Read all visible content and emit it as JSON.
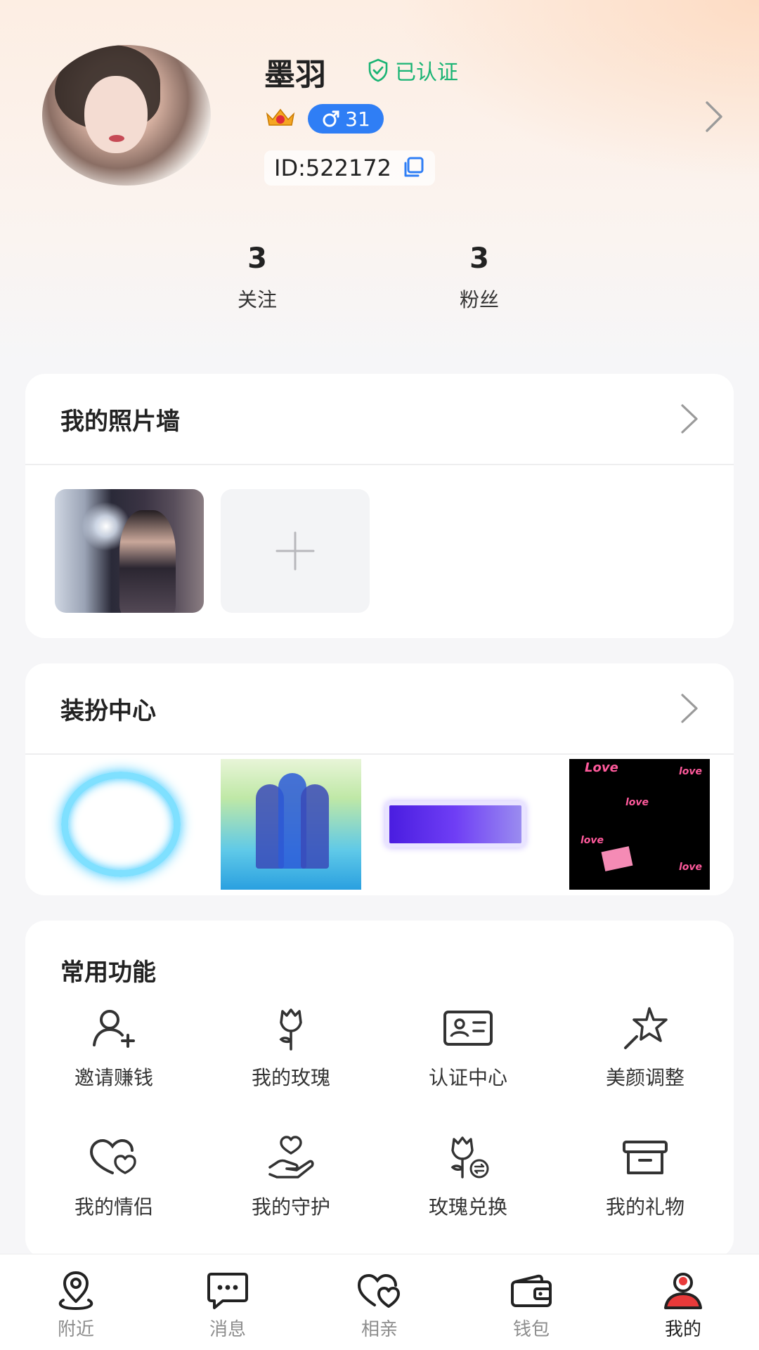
{
  "profile": {
    "name": "墨羽",
    "verified_label": "已认证",
    "gender_age": "31",
    "id_text": "ID:522172"
  },
  "stats": [
    {
      "value": "3",
      "label": "关注"
    },
    {
      "value": "3",
      "label": "粉丝"
    }
  ],
  "photo_wall": {
    "title": "我的照片墙"
  },
  "dress_center": {
    "title": "装扮中心",
    "love_texts": [
      "Love",
      "love",
      "love",
      "love",
      "love"
    ]
  },
  "common": {
    "title": "常用功能",
    "items": [
      {
        "label": "邀请赚钱",
        "icon": "invite-user-icon"
      },
      {
        "label": "我的玫瑰",
        "icon": "rose-icon"
      },
      {
        "label": "认证中心",
        "icon": "id-card-icon"
      },
      {
        "label": "美颜调整",
        "icon": "beauty-star-icon"
      },
      {
        "label": "我的情侣",
        "icon": "couple-heart-icon"
      },
      {
        "label": "我的守护",
        "icon": "guard-hand-icon"
      },
      {
        "label": "玫瑰兑换",
        "icon": "rose-exchange-icon"
      },
      {
        "label": "我的礼物",
        "icon": "gift-box-icon"
      }
    ]
  },
  "tabs": [
    {
      "label": "附近",
      "icon": "location-pin-icon"
    },
    {
      "label": "消息",
      "icon": "message-icon"
    },
    {
      "label": "相亲",
      "icon": "hearts-icon"
    },
    {
      "label": "钱包",
      "icon": "wallet-icon"
    },
    {
      "label": "我的",
      "icon": "profile-icon",
      "active": true
    }
  ],
  "colors": {
    "accent_green": "#1ab474",
    "badge_blue": "#2f7ef5",
    "active_red": "#e83a3a"
  }
}
